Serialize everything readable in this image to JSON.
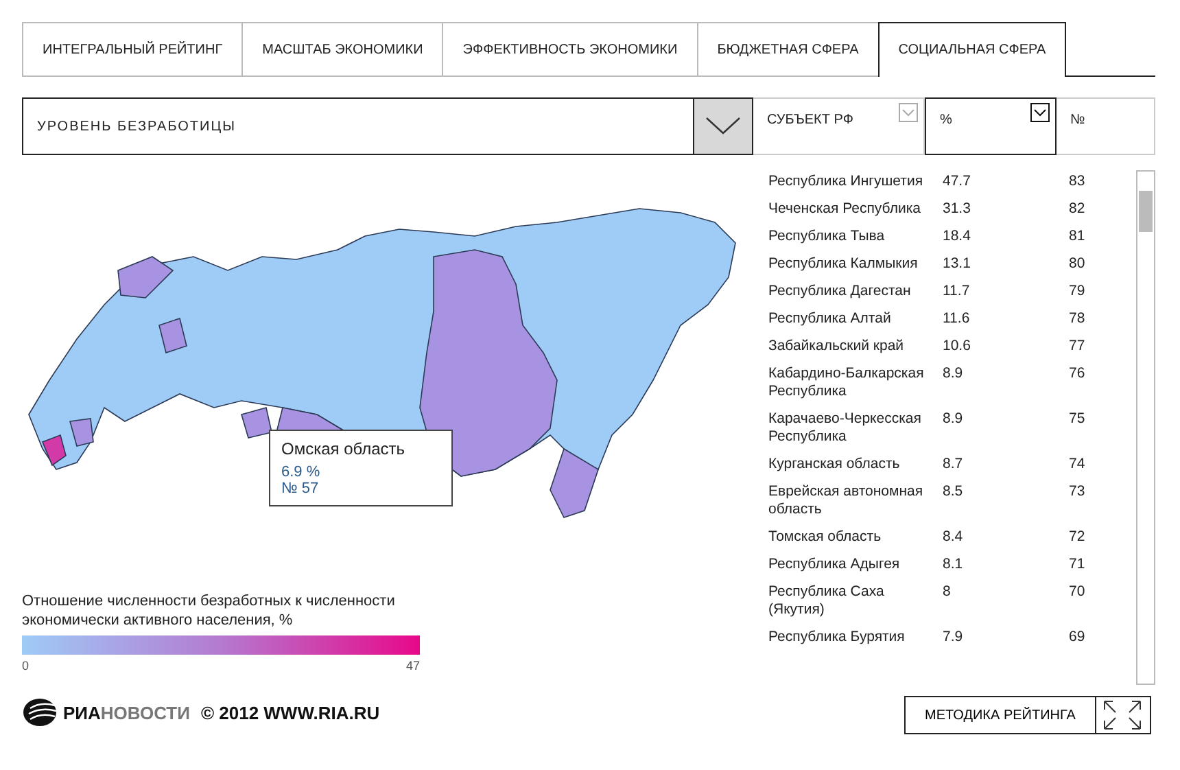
{
  "tabs": [
    {
      "label": "ИНТЕГРАЛЬНЫЙ РЕЙТИНГ",
      "selected": false
    },
    {
      "label": "МАСШТАБ ЭКОНОМИКИ",
      "selected": false
    },
    {
      "label": "ЭФФЕКТИВНОСТЬ ЭКОНОМИКИ",
      "selected": false
    },
    {
      "label": "БЮДЖЕТНАЯ СФЕРА",
      "selected": false
    },
    {
      "label": "СОЦИАЛЬНАЯ СФЕРА",
      "selected": true
    }
  ],
  "indicator_dropdown": {
    "value": "УРОВЕНЬ БЕЗРАБОТИЦЫ"
  },
  "table": {
    "columns": [
      {
        "label": "СУБЪЕКТ РФ",
        "sortable": true,
        "selected": false
      },
      {
        "label": "%",
        "sortable": true,
        "selected": true
      },
      {
        "label": "№",
        "sortable": false,
        "selected": false
      }
    ],
    "rows": [
      [
        "Республика Ингушетия",
        "47.7",
        "83"
      ],
      [
        "Чеченская Республика",
        "31.3",
        "82"
      ],
      [
        "Республика Тыва",
        "18.4",
        "81"
      ],
      [
        "Республика Калмыкия",
        "13.1",
        "80"
      ],
      [
        "Республика Дагестан",
        "11.7",
        "79"
      ],
      [
        "Республика Алтай",
        "11.6",
        "78"
      ],
      [
        "Забайкальский край",
        "10.6",
        "77"
      ],
      [
        "Кабардино-Балкарская Республика",
        "8.9",
        "76"
      ],
      [
        "Карачаево-Черкесская Республика",
        "8.9",
        "75"
      ],
      [
        "Курганская область",
        "8.7",
        "74"
      ],
      [
        "Еврейская автономная область",
        "8.5",
        "73"
      ],
      [
        "Томская область",
        "8.4",
        "72"
      ],
      [
        "Республика Адыгея",
        "8.1",
        "71"
      ],
      [
        "Республика Саха (Якутия)",
        "8",
        "70"
      ],
      [
        "Республика Бурятия",
        "7.9",
        "69"
      ]
    ]
  },
  "map_tooltip": {
    "region": "Омская область",
    "value": "6.9 %",
    "rank": "№ 57"
  },
  "legend": {
    "title": "Отношение численности безработных к численности экономически активного населения, %",
    "min": "0",
    "max": "47"
  },
  "footer": {
    "logo_bold": "РИА",
    "logo_light": "НОВОСТИ",
    "copyright": "© 2012 WWW.RIA.RU",
    "method_button": "МЕТОДИКА РЕЙТИНГА"
  }
}
